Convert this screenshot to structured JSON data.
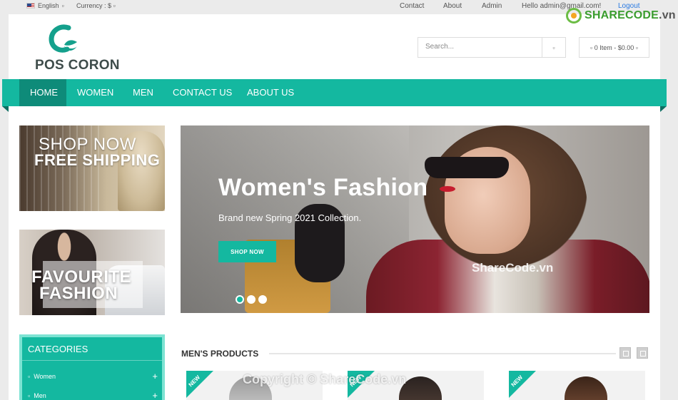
{
  "topbar": {
    "language": "English",
    "currency": "Currency : $",
    "links": [
      "Contact",
      "About",
      "Admin",
      "Hello admin@gmail.com!",
      "Logout"
    ]
  },
  "watermark_logo": {
    "text": "SHARECODE",
    "domain": ".vn"
  },
  "header": {
    "logo_text": "POS CORON",
    "search_placeholder": "Search...",
    "cart": "0 Item - $0.00"
  },
  "nav": {
    "items": [
      "HOME",
      "WOMEN",
      "MEN",
      "CONTACT US",
      "ABOUT US"
    ],
    "active": "HOME"
  },
  "banners": {
    "banner1": {
      "line1": "SHOP NOW",
      "line2": "FREE SHIPPING"
    },
    "banner2": {
      "line1": "FAVOURITE",
      "line2": "FASHION"
    }
  },
  "hero": {
    "title": "Women's Fashion",
    "subtitle": "Brand new Spring 2021 Collection.",
    "button": "SHOP NOW",
    "watermark": "ShareCode.vn",
    "slides": 3,
    "active_slide": 1
  },
  "categories": {
    "title": "CATEGORIES",
    "items": [
      "Women",
      "Men"
    ]
  },
  "products": {
    "title": "MEN'S PRODUCTS",
    "badge": "NEW",
    "watermark": "Copyright © ShareCode.vn"
  },
  "colors": {
    "accent": "#14b8a0",
    "accent_dark": "#0e8b79",
    "link": "#2a7ae2"
  }
}
